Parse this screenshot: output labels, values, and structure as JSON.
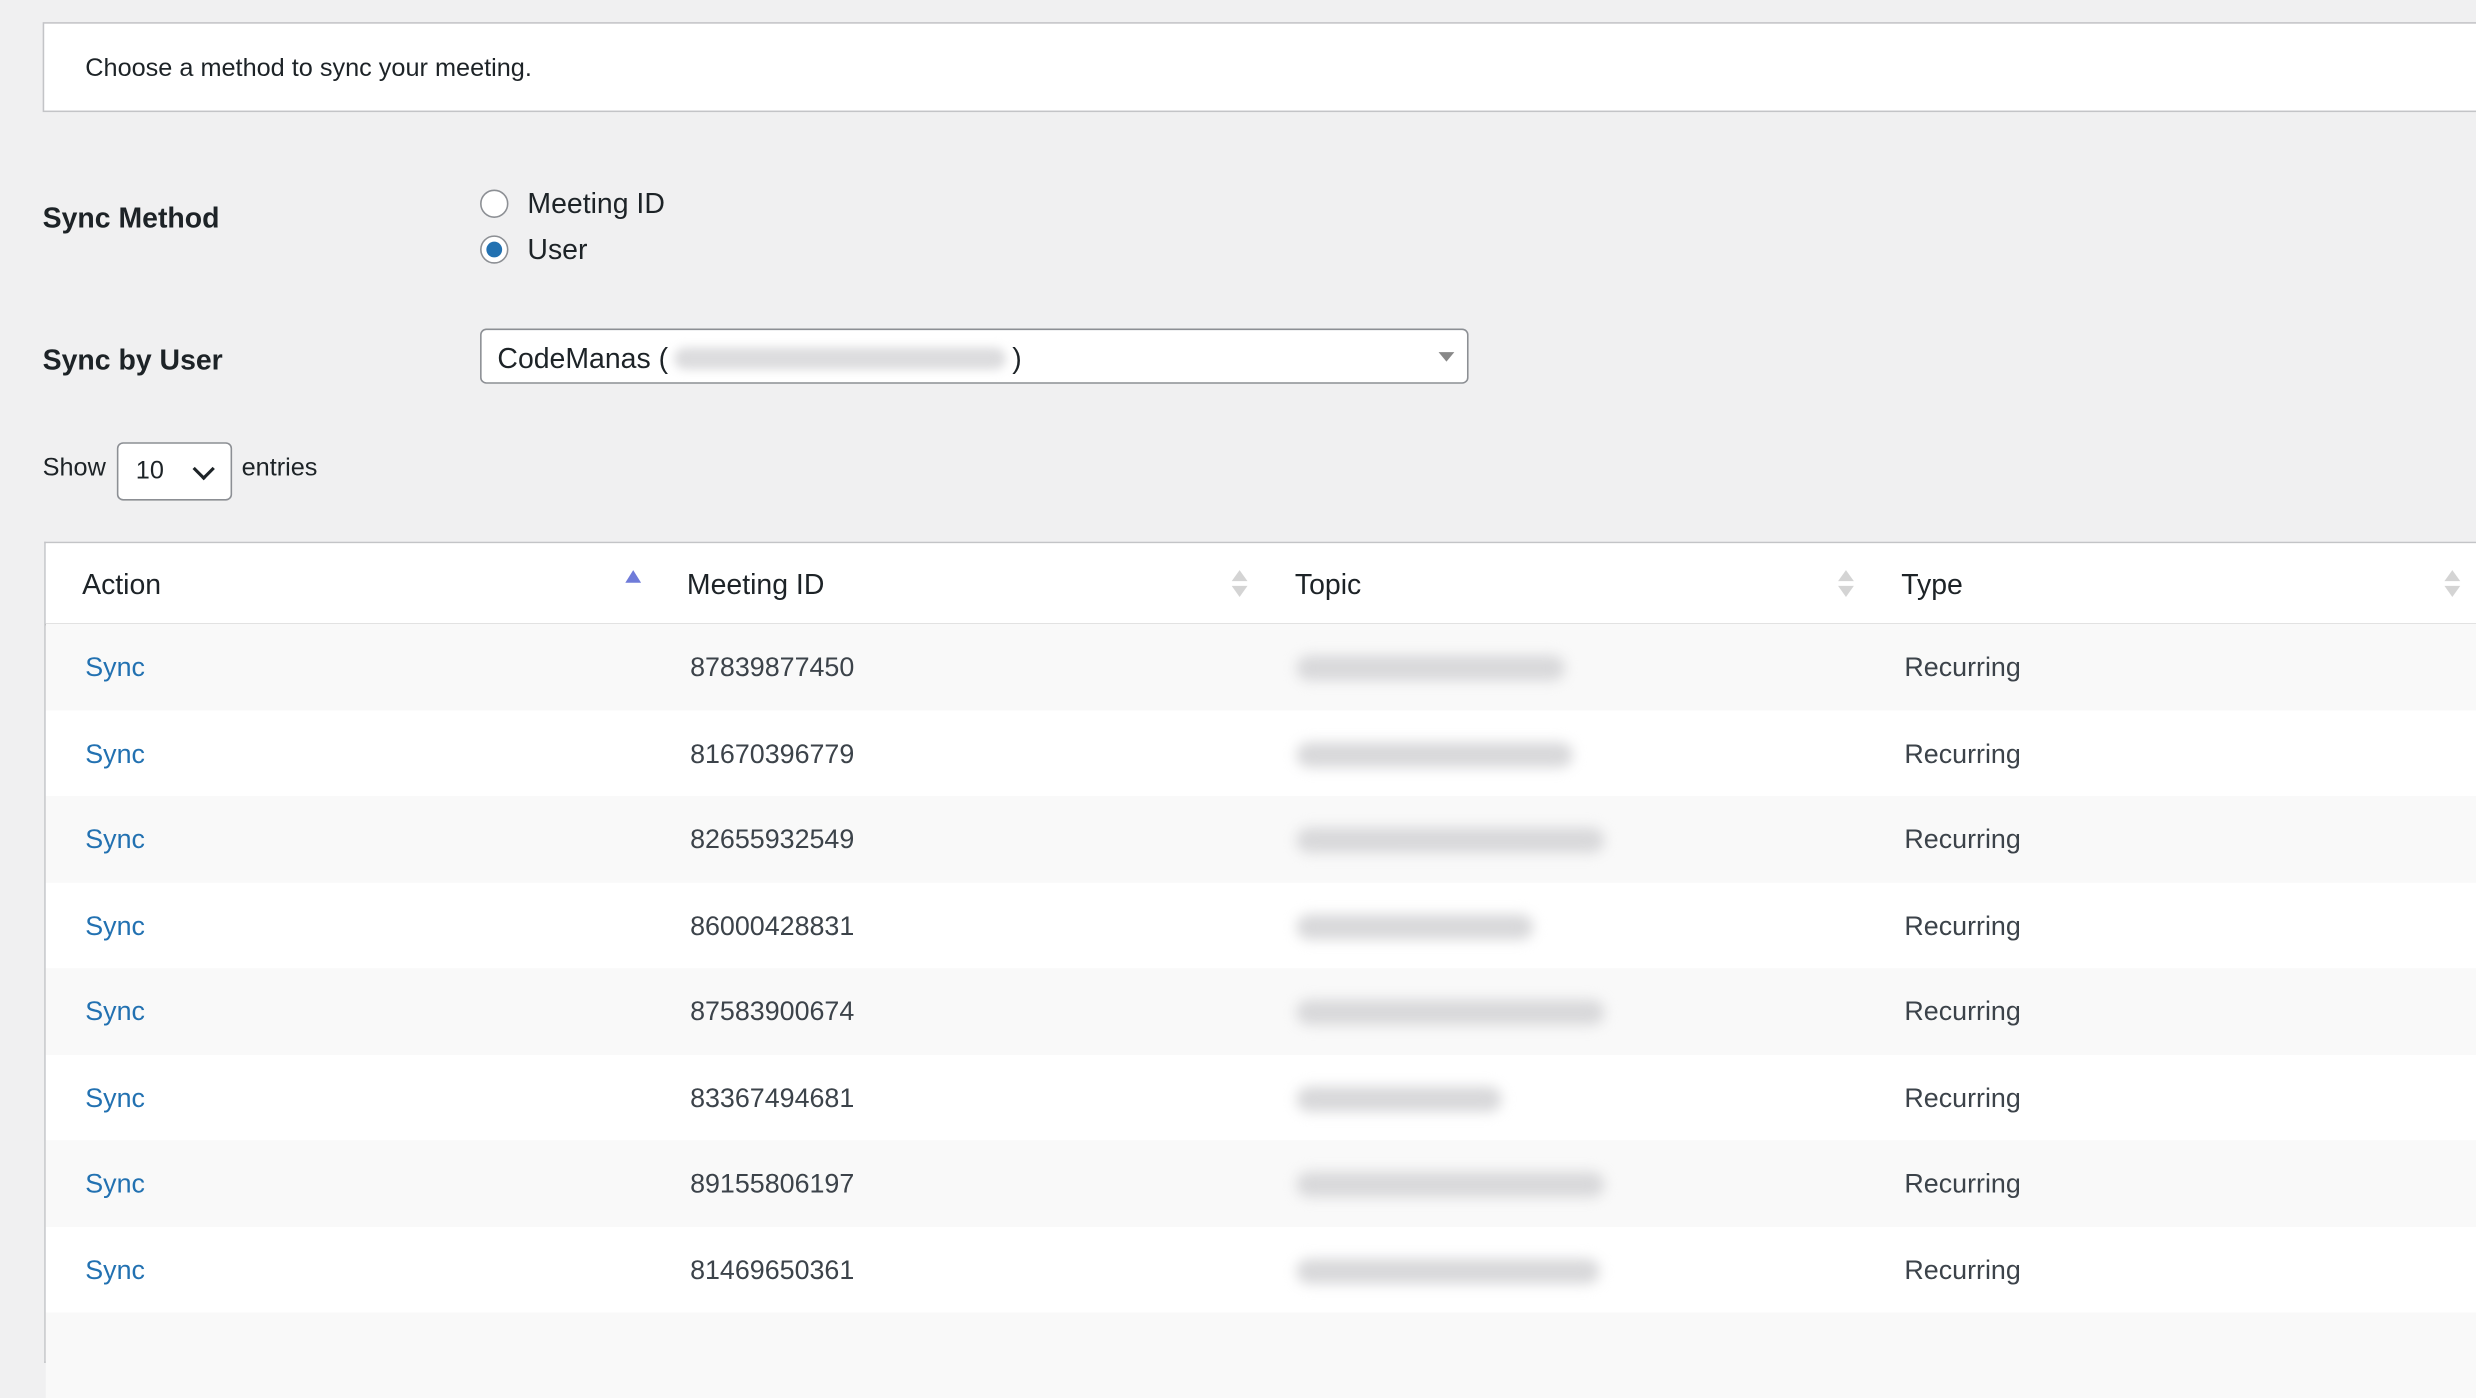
{
  "notice": {
    "text": "Choose a method to sync your meeting."
  },
  "sync_method": {
    "label": "Sync Method",
    "options": [
      {
        "label": "Meeting ID",
        "checked": false
      },
      {
        "label": "User",
        "checked": true
      }
    ]
  },
  "sync_by_user": {
    "label": "Sync by User",
    "selected_prefix": "CodeManas (",
    "selected_suffix": ")"
  },
  "length": {
    "show_label": "Show",
    "value": "10",
    "entries_label": "entries"
  },
  "table": {
    "columns": [
      {
        "label": "Action",
        "sort": "ascending"
      },
      {
        "label": "Meeting ID",
        "sort": "none"
      },
      {
        "label": "Topic",
        "sort": "none"
      },
      {
        "label": "Type",
        "sort": "none"
      }
    ],
    "rows": [
      {
        "action": "Sync",
        "meeting_id": "87839877450",
        "type": "Recurring"
      },
      {
        "action": "Sync",
        "meeting_id": "81670396779",
        "type": "Recurring"
      },
      {
        "action": "Sync",
        "meeting_id": "82655932549",
        "type": "Recurring"
      },
      {
        "action": "Sync",
        "meeting_id": "86000428831",
        "type": "Recurring"
      },
      {
        "action": "Sync",
        "meeting_id": "87583900674",
        "type": "Recurring"
      },
      {
        "action": "Sync",
        "meeting_id": "83367494681",
        "type": "Recurring"
      },
      {
        "action": "Sync",
        "meeting_id": "89155806197",
        "type": "Recurring"
      },
      {
        "action": "Sync",
        "meeting_id": "81469650361",
        "type": "Recurring"
      }
    ]
  },
  "colors": {
    "link": "#2271b1",
    "radio_checked": "#2271b1",
    "sort_active": "#6f7bd9",
    "background": "#f0f0f1"
  }
}
